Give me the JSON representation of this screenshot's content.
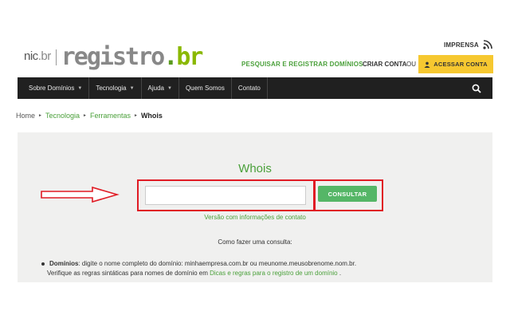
{
  "logo": {
    "nic": "nic",
    "nic_br": ".br",
    "main": "registro",
    "dot": ".",
    "br": "br"
  },
  "header": {
    "imprensa": "IMPRENSA",
    "pesquisar": "PESQUISAR E REGISTRAR DOMÍNIOS",
    "criar_conta": "CRIAR CONTA",
    "ou": "OU",
    "acessar_conta": "ACESSAR CONTA"
  },
  "nav": {
    "items": [
      {
        "label": "Sobre Domínios",
        "caret": "▼"
      },
      {
        "label": "Tecnologia",
        "caret": "▼"
      },
      {
        "label": "Ajuda",
        "caret": "▼"
      },
      {
        "label": "Quem Somos",
        "caret": ""
      },
      {
        "label": "Contato",
        "caret": ""
      }
    ]
  },
  "breadcrumb": {
    "home": "Home",
    "tecnologia": "Tecnologia",
    "ferramentas": "Ferramentas",
    "current": "Whois",
    "sep": "►"
  },
  "main": {
    "title": "Whois",
    "search_value": "",
    "search_placeholder": "",
    "consultar": "CONSULTAR",
    "versao": "Versão com informações de contato",
    "como": "Como fazer uma consulta:",
    "dominios_label": "Domínios",
    "dominios_text": ": digite o nome completo do domínio: minhaempresa.com.br ou meunome.meusobrenome.nom.br.",
    "verifique_text": "Verifique as regras sintáticas para nomes de domínio em ",
    "dicas_link": "Dicas e regras para o registro de um domínio",
    "end_dot": " ."
  },
  "colors": {
    "accent_green": "#4aa03a",
    "button_yellow": "#f6c830",
    "nav_bg": "#202020",
    "annotation_red": "#e01b24"
  }
}
